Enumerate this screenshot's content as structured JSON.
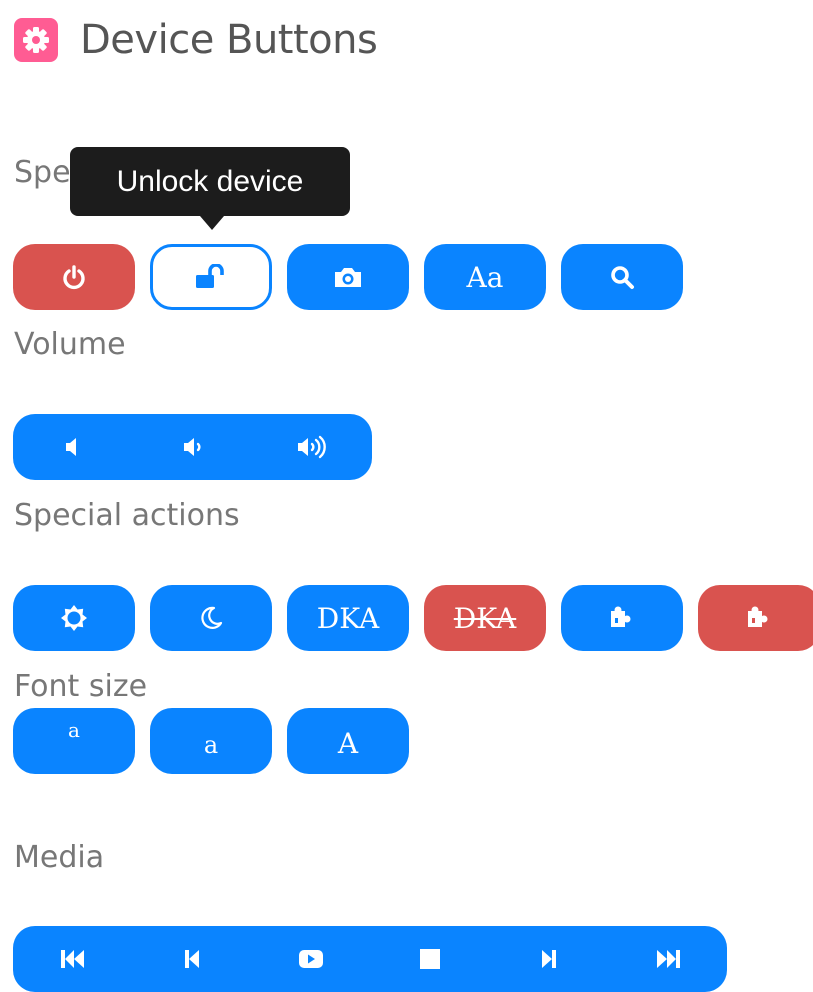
{
  "header": {
    "title": "Device Buttons",
    "icon": "gear-icon",
    "icon_color": "#ff5c93"
  },
  "colors": {
    "primary": "#0a84ff",
    "danger": "#d9534f",
    "tooltip_bg": "#1c1c1c"
  },
  "special_keys": {
    "label": "Special Keys",
    "buttons": [
      {
        "name": "power-button",
        "icon": "power-icon",
        "style": "red"
      },
      {
        "name": "unlock-button",
        "icon": "unlock-icon",
        "style": "outline"
      },
      {
        "name": "screenshot-button",
        "icon": "camera-icon",
        "style": "blue"
      },
      {
        "name": "font-button",
        "text": "Aa",
        "style": "blue"
      },
      {
        "name": "search-button",
        "icon": "search-icon",
        "style": "blue"
      }
    ]
  },
  "tooltip": {
    "text": "Unlock device"
  },
  "volume": {
    "label": "Volume",
    "buttons": [
      "volume-mute-icon",
      "volume-down-icon",
      "volume-up-icon"
    ]
  },
  "special_actions": {
    "label": "Special actions",
    "buttons": [
      {
        "name": "brightness-button",
        "icon": "sun-icon",
        "style": "blue"
      },
      {
        "name": "dark-mode-button",
        "icon": "moon-icon",
        "style": "blue"
      },
      {
        "name": "dka-on-button",
        "text": "DKA",
        "style": "blue"
      },
      {
        "name": "dka-off-button",
        "text": "DKA",
        "style": "red",
        "strikethrough": true
      },
      {
        "name": "plugin-enable-button",
        "icon": "puzzle-icon",
        "style": "blue"
      },
      {
        "name": "plugin-disable-button",
        "icon": "puzzle-icon",
        "style": "red"
      }
    ]
  },
  "font_size": {
    "label": "Font size",
    "buttons": [
      {
        "name": "font-small-button",
        "text": "a"
      },
      {
        "name": "font-medium-button",
        "text": "a"
      },
      {
        "name": "font-large-button",
        "text": "A"
      }
    ]
  },
  "media": {
    "label": "Media",
    "buttons": [
      "fast-backward-icon",
      "step-backward-icon",
      "play-icon",
      "stop-icon",
      "step-forward-icon",
      "fast-forward-icon"
    ]
  }
}
